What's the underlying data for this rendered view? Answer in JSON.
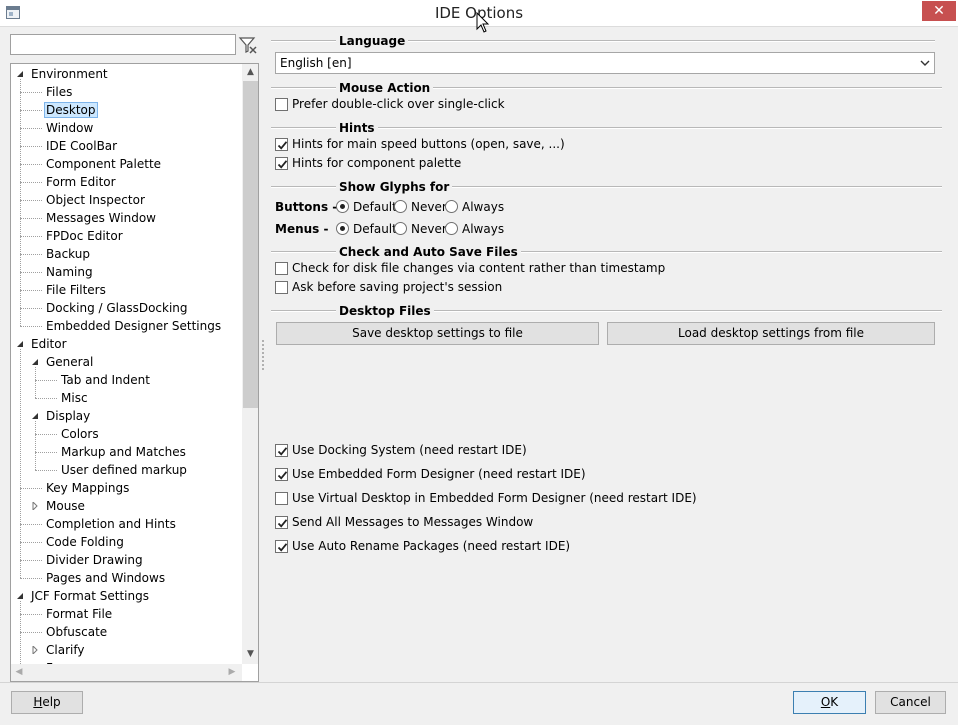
{
  "window": {
    "title": "IDE Options",
    "close_glyph": "✕"
  },
  "filter": {
    "value": "",
    "placeholder": ""
  },
  "tree": {
    "items": [
      {
        "label": "Environment",
        "level": 0,
        "expander": "expanded"
      },
      {
        "label": "Files",
        "level": 1
      },
      {
        "label": "Desktop",
        "level": 1,
        "selected": true
      },
      {
        "label": "Window",
        "level": 1
      },
      {
        "label": "IDE CoolBar",
        "level": 1
      },
      {
        "label": "Component Palette",
        "level": 1
      },
      {
        "label": "Form Editor",
        "level": 1
      },
      {
        "label": "Object Inspector",
        "level": 1
      },
      {
        "label": "Messages Window",
        "level": 1
      },
      {
        "label": "FPDoc Editor",
        "level": 1
      },
      {
        "label": "Backup",
        "level": 1
      },
      {
        "label": "Naming",
        "level": 1
      },
      {
        "label": "File Filters",
        "level": 1
      },
      {
        "label": "Docking / GlassDocking",
        "level": 1
      },
      {
        "label": "Embedded Designer Settings",
        "level": 1
      },
      {
        "label": "Editor",
        "level": 0,
        "expander": "expanded"
      },
      {
        "label": "General",
        "level": 1,
        "expander": "expanded"
      },
      {
        "label": "Tab and Indent",
        "level": 2
      },
      {
        "label": "Misc",
        "level": 2
      },
      {
        "label": "Display",
        "level": 1,
        "expander": "expanded"
      },
      {
        "label": "Colors",
        "level": 2
      },
      {
        "label": "Markup and Matches",
        "level": 2
      },
      {
        "label": "User defined markup",
        "level": 2
      },
      {
        "label": "Key Mappings",
        "level": 1
      },
      {
        "label": "Mouse",
        "level": 1,
        "expander": "collapsed"
      },
      {
        "label": "Completion and Hints",
        "level": 1
      },
      {
        "label": "Code Folding",
        "level": 1
      },
      {
        "label": "Divider Drawing",
        "level": 1
      },
      {
        "label": "Pages and Windows",
        "level": 1
      },
      {
        "label": "JCF Format Settings",
        "level": 0,
        "expander": "expanded"
      },
      {
        "label": "Format File",
        "level": 1
      },
      {
        "label": "Obfuscate",
        "level": 1
      },
      {
        "label": "Clarify",
        "level": 1,
        "expander": "collapsed"
      },
      {
        "label": "Fo...",
        "level": 1,
        "expander": "collapsed"
      }
    ]
  },
  "language": {
    "section": "Language",
    "selected": "English [en]"
  },
  "mouse_action": {
    "section": "Mouse Action",
    "prefer_double_click": {
      "label": "Prefer double-click over single-click",
      "checked": false
    }
  },
  "hints": {
    "section": "Hints",
    "main_speed_buttons": {
      "label": "Hints for main speed buttons (open, save, ...)",
      "checked": true
    },
    "component_palette": {
      "label": "Hints for component palette",
      "checked": true
    }
  },
  "glyphs": {
    "section": "Show Glyphs for",
    "buttons_label": "Buttons -",
    "menus_label": "Menus -",
    "options": [
      "Default",
      "Never",
      "Always"
    ],
    "buttons_selected": "Default",
    "menus_selected": "Default"
  },
  "autosave": {
    "section": "Check and Auto Save Files",
    "disk_changes": {
      "label": "Check for disk file changes via content rather than timestamp",
      "checked": false
    },
    "ask_before_saving": {
      "label": "Ask before saving project's session",
      "checked": false
    }
  },
  "desktop_files": {
    "section": "Desktop Files",
    "save_label": "Save desktop settings to file",
    "load_label": "Load desktop settings from file"
  },
  "docking": {
    "use_docking": {
      "label": "Use Docking System (need restart IDE)",
      "checked": true
    },
    "embedded_designer": {
      "label": "Use Embedded Form Designer  (need restart IDE)",
      "checked": true
    },
    "virtual_desktop": {
      "label": "Use Virtual Desktop in Embedded Form Designer  (need restart IDE)",
      "checked": false
    },
    "send_messages": {
      "label": "Send All Messages to Messages Window",
      "checked": true
    },
    "auto_rename": {
      "label": "Use Auto Rename Packages  (need restart IDE)",
      "checked": true
    }
  },
  "footer": {
    "help_prefix": "",
    "help_mnemonic": "H",
    "help_rest": "elp",
    "ok_mnemonic": "O",
    "ok_rest": "K",
    "cancel_label": "Cancel"
  },
  "colors": {
    "close_button": "#c75050",
    "selection": "#cde8ff",
    "default_button_border": "#3c7fb1"
  }
}
